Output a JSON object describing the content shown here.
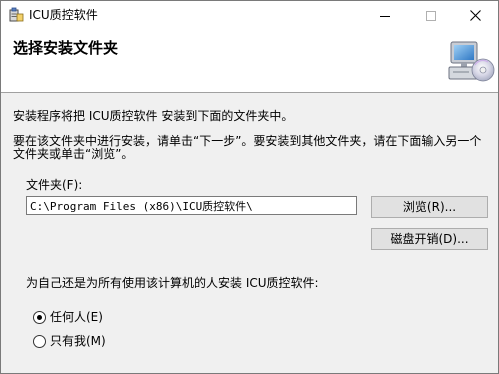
{
  "window": {
    "title": "ICU质控软件",
    "minimize_glyph": "—",
    "maximize_glyph": "☐",
    "close_glyph": "✕"
  },
  "header": {
    "title": "选择安装文件夹",
    "icon": "computer-cd-icon"
  },
  "body": {
    "info_line1": "安装程序将把 ICU质控软件 安装到下面的文件夹中。",
    "info_line2": "要在该文件夹中进行安装，请单击“下一步”。要安装到其他文件夹，请在下面输入另一个文件夹或单击“浏览”。"
  },
  "folder": {
    "label": "文件夹(F):",
    "value": "C:\\Program Files (x86)\\ICU质控软件\\"
  },
  "buttons": {
    "browse": "浏览(R)...",
    "disk_cost": "磁盘开销(D)..."
  },
  "install_for": {
    "question": "为自己还是为所有使用该计算机的人安装 ICU质控软件:",
    "options": [
      {
        "label": "任何人(E)",
        "selected": true
      },
      {
        "label": "只有我(M)",
        "selected": false
      }
    ]
  }
}
